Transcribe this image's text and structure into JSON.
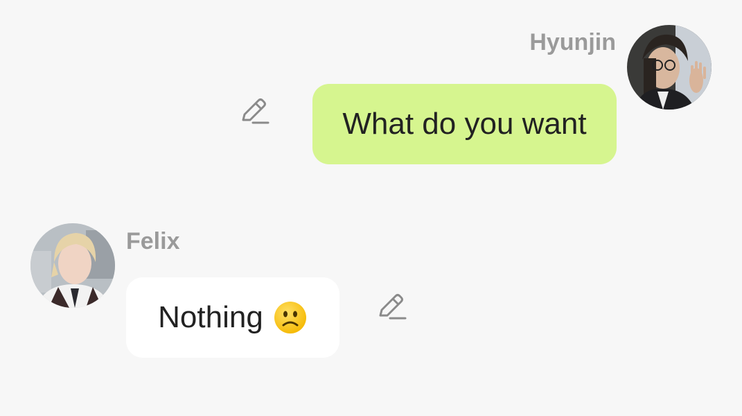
{
  "messages": [
    {
      "sender": "Hyunjin",
      "text": "What do you want",
      "side": "right",
      "bubble_color": "#d6f58f",
      "avatar_icon": "avatar-photo"
    },
    {
      "sender": "Felix",
      "text": "Nothing",
      "emoji": "slightly-frowning-face",
      "side": "left",
      "bubble_color": "#ffffff",
      "avatar_icon": "avatar-photo"
    }
  ],
  "icons": {
    "edit": "pencil-icon"
  },
  "colors": {
    "background": "#f7f7f7",
    "sender_name": "#9a9a9a",
    "message_text": "#222222",
    "edit_icon": "#8a8a8a"
  }
}
